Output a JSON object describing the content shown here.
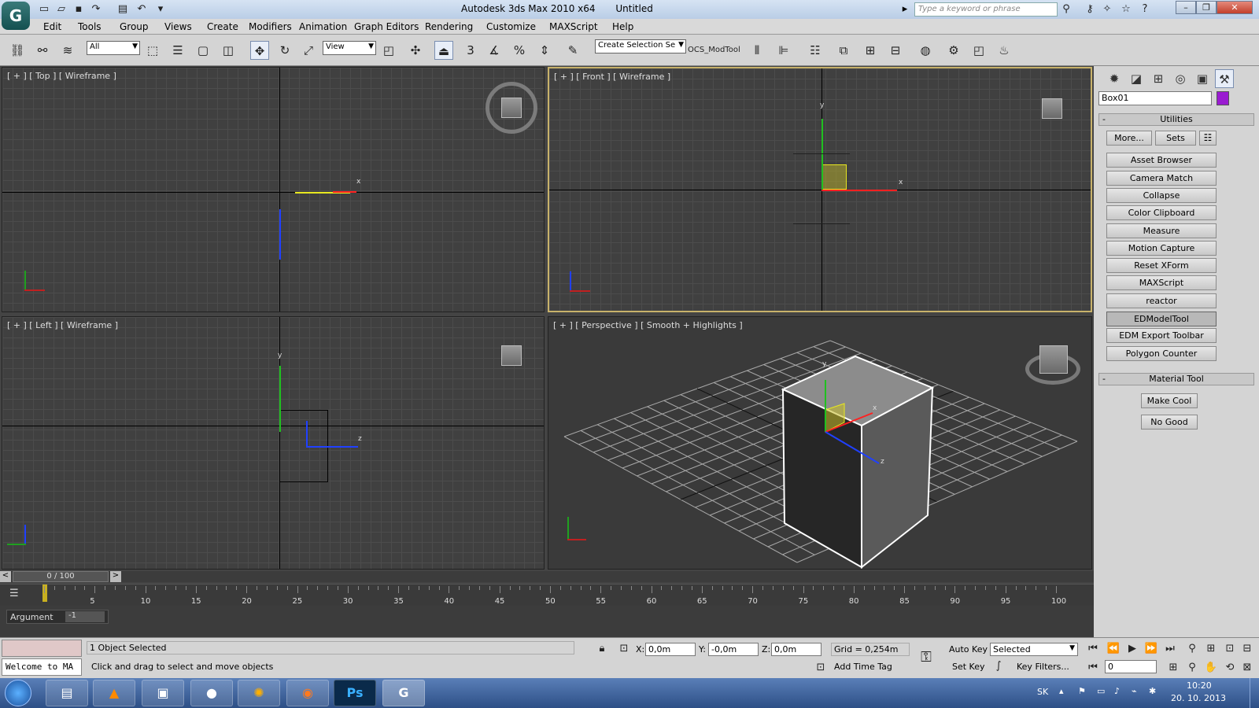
{
  "title_bar": {
    "app_title": "Autodesk 3ds Max  2010 x64",
    "doc_title": "Untitled",
    "search_placeholder": "Type a keyword or phrase",
    "window_buttons": {
      "minimize": "–",
      "restore": "❐",
      "close": "✕"
    }
  },
  "menu": {
    "items": [
      "Edit",
      "Tools",
      "Group",
      "Views",
      "Create",
      "Modifiers",
      "Animation",
      "Graph Editors",
      "Rendering",
      "Customize",
      "MAXScript",
      "Help"
    ]
  },
  "toolbar": {
    "filter_value": "All",
    "coord_value": "View",
    "selection_set_value": "Create Selection Se",
    "ocs_label": "OCS_ModTool",
    "snap_label": "3",
    "snap_label2": "%"
  },
  "viewports": {
    "top": {
      "label": "[ + ] [ Top ] [ Wireframe ]"
    },
    "front": {
      "label": "[ + ] [ Front ] [ Wireframe ]"
    },
    "left": {
      "label": "[ + ] [ Left ] [ Wireframe ]"
    },
    "perspective": {
      "label": "[ + ] [ Perspective ] [ Smooth + Highlights ]"
    },
    "axis": {
      "x": "x",
      "y": "y",
      "z": "z"
    }
  },
  "command_panel": {
    "object_name": "Box01",
    "object_color": "#9a1bd1",
    "utilities_title": "Utilities",
    "more_label": "More...",
    "sets_label": "Sets",
    "utility_buttons": [
      "Asset Browser",
      "Camera Match",
      "Collapse",
      "Color Clipboard",
      "Measure",
      "Motion Capture",
      "Reset XForm",
      "MAXScript",
      "reactor",
      "EDModelTool",
      "EDM Export Toolbar",
      "Polygon Counter"
    ],
    "pressed_button": "EDModelTool",
    "material_tool_title": "Material Tool",
    "material_buttons": [
      "Make Cool",
      "No Good"
    ]
  },
  "timeline": {
    "frame_display": "0 / 100",
    "ticks": [
      "5",
      "10",
      "15",
      "20",
      "25",
      "30",
      "35",
      "40",
      "45",
      "50",
      "55",
      "60",
      "65",
      "70",
      "75",
      "80",
      "85",
      "90",
      "95",
      "100"
    ]
  },
  "argument": {
    "label": "Argument",
    "value": "-1"
  },
  "status": {
    "selection": "1 Object Selected",
    "prompt": "Click and drag to select and move objects",
    "welcome": "Welcome to MA",
    "x_label": "X:",
    "x_value": "0,0m",
    "y_label": "Y:",
    "y_value": "-0,0m",
    "z_label": "Z:",
    "z_value": "0,0m",
    "grid": "Grid = 0,254m",
    "add_time_tag": "Add Time Tag",
    "auto_key": "Auto Key",
    "set_key": "Set Key",
    "key_mode_value": "Selected",
    "key_filters": "Key Filters...",
    "frame_value": "0"
  },
  "taskbar": {
    "photoshop_label": "Ps",
    "language": "SK",
    "time": "10:20",
    "date": "20. 10. 2013"
  }
}
